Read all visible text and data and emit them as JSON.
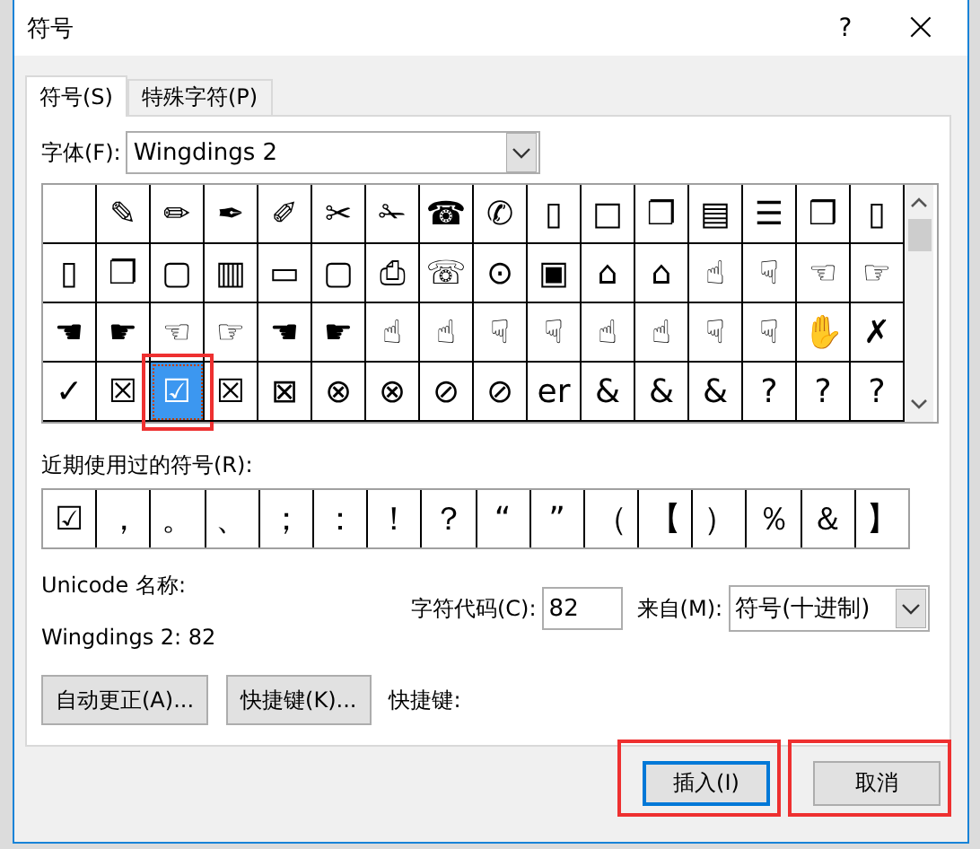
{
  "window": {
    "title": "符号",
    "help": "?",
    "close": "×"
  },
  "tabs": [
    {
      "label": "符号(S)",
      "selected": true
    },
    {
      "label": "特殊字符(P)",
      "selected": false
    }
  ],
  "font": {
    "label": "字体(F):",
    "value": "Wingdings 2"
  },
  "grid": [
    [
      {
        "kind": "blank",
        "selected": false,
        "highlighted": false
      },
      {
        "kind": "glyph",
        "glyph": "✎",
        "selected": false,
        "highlighted": false
      },
      {
        "kind": "glyph",
        "glyph": "✏",
        "selected": false,
        "highlighted": false
      },
      {
        "kind": "glyph",
        "glyph": "✒",
        "selected": false,
        "highlighted": false
      },
      {
        "kind": "glyph",
        "glyph": "✐",
        "selected": false,
        "highlighted": false
      },
      {
        "kind": "glyph",
        "glyph": "✂",
        "selected": false,
        "highlighted": false
      },
      {
        "kind": "glyph",
        "glyph": "✁",
        "selected": false,
        "highlighted": false
      },
      {
        "kind": "glyph",
        "glyph": "☎",
        "selected": false,
        "highlighted": false
      },
      {
        "kind": "glyph",
        "glyph": "✆",
        "selected": false,
        "highlighted": false
      },
      {
        "kind": "glyph",
        "glyph": "▯",
        "selected": false,
        "highlighted": false
      },
      {
        "kind": "glyph",
        "glyph": "□",
        "selected": false,
        "highlighted": false
      },
      {
        "kind": "glyph",
        "glyph": "❐",
        "selected": false,
        "highlighted": false
      },
      {
        "kind": "glyph",
        "glyph": "▤",
        "selected": false,
        "highlighted": false
      },
      {
        "kind": "glyph",
        "glyph": "☰",
        "selected": false,
        "highlighted": false
      },
      {
        "kind": "glyph",
        "glyph": "❒",
        "selected": false,
        "highlighted": false
      },
      {
        "kind": "glyph",
        "glyph": "▯",
        "selected": false,
        "highlighted": false
      }
    ],
    [
      {
        "kind": "glyph",
        "glyph": "▯",
        "selected": false,
        "highlighted": false
      },
      {
        "kind": "glyph",
        "glyph": "❐",
        "selected": false,
        "highlighted": false
      },
      {
        "kind": "glyph",
        "glyph": "▢",
        "selected": false,
        "highlighted": false
      },
      {
        "kind": "glyph",
        "glyph": "▥",
        "selected": false,
        "highlighted": false
      },
      {
        "kind": "glyph",
        "glyph": "▭",
        "selected": false,
        "highlighted": false
      },
      {
        "kind": "glyph",
        "glyph": "▢",
        "selected": false,
        "highlighted": false
      },
      {
        "kind": "glyph",
        "glyph": "⎙",
        "selected": false,
        "highlighted": false
      },
      {
        "kind": "glyph",
        "glyph": "☏",
        "selected": false,
        "highlighted": false
      },
      {
        "kind": "glyph",
        "glyph": "⊙",
        "selected": false,
        "highlighted": false
      },
      {
        "kind": "glyph",
        "glyph": "▣",
        "selected": false,
        "highlighted": false
      },
      {
        "kind": "glyph",
        "glyph": "⌂",
        "selected": false,
        "highlighted": false
      },
      {
        "kind": "glyph",
        "glyph": "⌂",
        "selected": false,
        "highlighted": false
      },
      {
        "kind": "glyph",
        "glyph": "☝",
        "selected": false,
        "highlighted": false
      },
      {
        "kind": "glyph",
        "glyph": "☟",
        "selected": false,
        "highlighted": false
      },
      {
        "kind": "glyph",
        "glyph": "☜",
        "selected": false,
        "highlighted": false
      },
      {
        "kind": "glyph",
        "glyph": "☞",
        "selected": false,
        "highlighted": false
      }
    ],
    [
      {
        "kind": "glyph",
        "glyph": "☚",
        "selected": false,
        "highlighted": false
      },
      {
        "kind": "glyph",
        "glyph": "☛",
        "selected": false,
        "highlighted": false
      },
      {
        "kind": "glyph",
        "glyph": "☜",
        "selected": false,
        "highlighted": false
      },
      {
        "kind": "glyph",
        "glyph": "☞",
        "selected": false,
        "highlighted": false
      },
      {
        "kind": "glyph",
        "glyph": "☚",
        "selected": false,
        "highlighted": false
      },
      {
        "kind": "glyph",
        "glyph": "☛",
        "selected": false,
        "highlighted": false
      },
      {
        "kind": "glyph",
        "glyph": "☝",
        "selected": false,
        "highlighted": false
      },
      {
        "kind": "glyph",
        "glyph": "☝",
        "selected": false,
        "highlighted": false
      },
      {
        "kind": "glyph",
        "glyph": "☟",
        "selected": false,
        "highlighted": false
      },
      {
        "kind": "glyph",
        "glyph": "☟",
        "selected": false,
        "highlighted": false
      },
      {
        "kind": "glyph",
        "glyph": "☝",
        "selected": false,
        "highlighted": false
      },
      {
        "kind": "glyph",
        "glyph": "☝",
        "selected": false,
        "highlighted": false
      },
      {
        "kind": "glyph",
        "glyph": "☟",
        "selected": false,
        "highlighted": false
      },
      {
        "kind": "glyph",
        "glyph": "☟",
        "selected": false,
        "highlighted": false
      },
      {
        "kind": "glyph",
        "glyph": "✋",
        "selected": false,
        "highlighted": false
      },
      {
        "kind": "glyph",
        "glyph": "✗",
        "selected": false,
        "highlighted": false
      }
    ],
    [
      {
        "kind": "glyph",
        "glyph": "✓",
        "selected": false,
        "highlighted": false
      },
      {
        "kind": "glyph",
        "glyph": "☒",
        "selected": false,
        "highlighted": false
      },
      {
        "kind": "glyph",
        "glyph": "☑",
        "selected": true,
        "highlighted": true
      },
      {
        "kind": "glyph",
        "glyph": "☒",
        "selected": false,
        "highlighted": false
      },
      {
        "kind": "glyph",
        "glyph": "⊠",
        "selected": false,
        "highlighted": false
      },
      {
        "kind": "glyph",
        "glyph": "⊗",
        "selected": false,
        "highlighted": false
      },
      {
        "kind": "glyph",
        "glyph": "⊗",
        "selected": false,
        "highlighted": false
      },
      {
        "kind": "glyph",
        "glyph": "⊘",
        "selected": false,
        "highlighted": false
      },
      {
        "kind": "glyph",
        "glyph": "⊘",
        "selected": false,
        "highlighted": false
      },
      {
        "kind": "glyph",
        "glyph": "er",
        "selected": false,
        "highlighted": false
      },
      {
        "kind": "glyph",
        "glyph": "&",
        "selected": false,
        "highlighted": false
      },
      {
        "kind": "glyph",
        "glyph": "&",
        "selected": false,
        "highlighted": false
      },
      {
        "kind": "glyph",
        "glyph": "&",
        "selected": false,
        "highlighted": false
      },
      {
        "kind": "glyph",
        "glyph": "?",
        "selected": false,
        "highlighted": false
      },
      {
        "kind": "glyph",
        "glyph": "?",
        "selected": false,
        "highlighted": false
      },
      {
        "kind": "glyph",
        "glyph": "?",
        "selected": false,
        "highlighted": false
      }
    ]
  ],
  "recent": {
    "label": "近期使用过的符号(R):",
    "symbols": [
      "☑",
      "，",
      "。",
      "、",
      "；",
      "：",
      "！",
      "？",
      "“",
      "”",
      "（",
      "【",
      "）",
      "％",
      "＆",
      "】"
    ]
  },
  "unicode_name": {
    "label": "Unicode 名称:",
    "value": "Wingdings 2: 82"
  },
  "char_code": {
    "label": "字符代码(C):",
    "value": "82"
  },
  "from": {
    "label": "来自(M):",
    "value": "符号(十进制)"
  },
  "buttons": [
    {
      "label": "自动更正(A)..."
    },
    {
      "label": "快捷键(K)..."
    }
  ],
  "shortcut_label": "快捷键:",
  "footer_buttons": [
    {
      "label": "插入(I)",
      "default": true,
      "highlighted": true
    },
    {
      "label": "取消",
      "default": false,
      "highlighted": true
    }
  ]
}
